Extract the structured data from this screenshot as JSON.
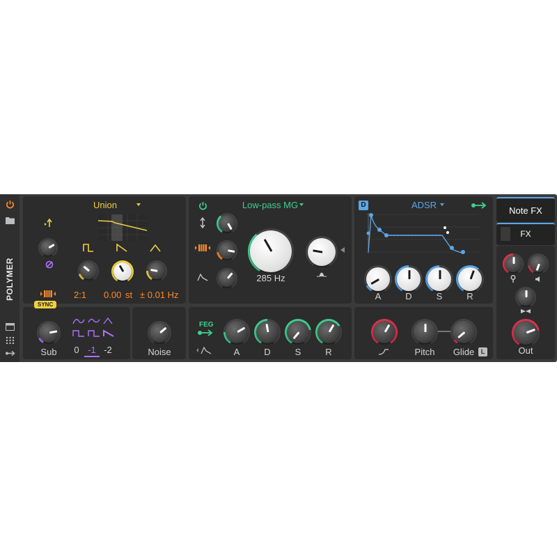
{
  "device": {
    "name": "POLYMER"
  },
  "oscillator": {
    "wavetable": "Union",
    "ratio": "2:1",
    "pitch": "0.00",
    "pitch_unit": "st",
    "detune": "± 0.01 Hz",
    "sync_badge": "SYNC"
  },
  "sub": {
    "label": "Sub",
    "octaves": [
      "0",
      "-1",
      "-2"
    ],
    "selected_octave": "-1"
  },
  "noise": {
    "label": "Noise"
  },
  "filter": {
    "type": "Low-pass MG",
    "cutoff": "285 Hz"
  },
  "feg": {
    "badge": "FEG",
    "labels": [
      "A",
      "D",
      "S",
      "R"
    ]
  },
  "aeg": {
    "badge": "D",
    "type": "ADSR",
    "labels": [
      "A",
      "D",
      "S",
      "R"
    ]
  },
  "glide_section": {
    "pitch": "Pitch",
    "glide": "Glide",
    "legato_badge": "L"
  },
  "fx": {
    "note_fx": "Note FX",
    "fx": "FX",
    "out": "Out"
  },
  "colors": {
    "osc_accent": "#f0d040",
    "pitch_orange": "#ff8a2a",
    "filter_accent": "#3ecf8e",
    "env_blue": "#5aa6e8",
    "sub_purple": "#b070ff",
    "out_red": "#e0324a"
  }
}
